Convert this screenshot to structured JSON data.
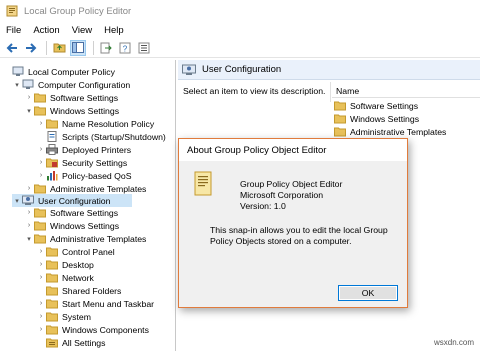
{
  "window": {
    "title": "Local Group Policy Editor"
  },
  "menu": [
    "File",
    "Action",
    "View",
    "Help"
  ],
  "toolbar": {
    "icons": [
      "back-arrow-icon",
      "forward-arrow-icon",
      "folder-up-icon",
      "show-hide-tree-icon",
      "export-list-icon",
      "help-icon",
      "properties-icon"
    ]
  },
  "tree": {
    "items": [
      {
        "label": "Local Computer Policy",
        "icon": "computer-icon",
        "expander": ""
      },
      {
        "label": "Computer Configuration",
        "icon": "computer-icon",
        "expander": "▾"
      },
      {
        "label": "Software Settings",
        "icon": "folder-icon",
        "expander": "›"
      },
      {
        "label": "Windows Settings",
        "icon": "folder-icon",
        "expander": "▾"
      },
      {
        "label": "Name Resolution Policy",
        "icon": "folder-icon",
        "expander": "›"
      },
      {
        "label": "Scripts (Startup/Shutdown)",
        "icon": "script-icon",
        "expander": ""
      },
      {
        "label": "Deployed Printers",
        "icon": "printer-icon",
        "expander": "›"
      },
      {
        "label": "Security Settings",
        "icon": "security-icon",
        "expander": "›"
      },
      {
        "label": "Policy-based QoS",
        "icon": "chart-icon",
        "expander": "›"
      },
      {
        "label": "Administrative Templates",
        "icon": "folder-icon",
        "expander": "›"
      },
      {
        "label": "User Configuration",
        "icon": "user-icon",
        "expander": "▾"
      },
      {
        "label": "Software Settings",
        "icon": "folder-icon",
        "expander": "›"
      },
      {
        "label": "Windows Settings",
        "icon": "folder-icon",
        "expander": "›"
      },
      {
        "label": "Administrative Templates",
        "icon": "folder-icon",
        "expander": "▾"
      },
      {
        "label": "Control Panel",
        "icon": "folder-icon",
        "expander": "›"
      },
      {
        "label": "Desktop",
        "icon": "folder-icon",
        "expander": "›"
      },
      {
        "label": "Network",
        "icon": "folder-icon",
        "expander": "›"
      },
      {
        "label": "Shared Folders",
        "icon": "folder-icon",
        "expander": ""
      },
      {
        "label": "Start Menu and Taskbar",
        "icon": "folder-icon",
        "expander": "›"
      },
      {
        "label": "System",
        "icon": "folder-icon",
        "expander": "›"
      },
      {
        "label": "Windows Components",
        "icon": "folder-icon",
        "expander": "›"
      },
      {
        "label": "All Settings",
        "icon": "settings-icon",
        "expander": ""
      }
    ]
  },
  "right_pane": {
    "header": "User Configuration",
    "description": "Select an item to view its description.",
    "column_name": "Name",
    "items": [
      "Software Settings",
      "Windows Settings",
      "Administrative Templates"
    ]
  },
  "dialog": {
    "title": "About Group Policy Object Editor",
    "product": "Group Policy Object Editor",
    "company": "Microsoft Corporation",
    "version": "Version: 1.0",
    "desc_line1": "This snap-in allows you to edit the local Group",
    "desc_line2": "Policy Objects stored on a computer.",
    "ok_label": "OK"
  },
  "watermark": "wsxdn.com",
  "colors": {
    "selection": "#cce4f7",
    "folder": "#e8c15a",
    "dialog_border": "#e07b3c",
    "ok_border": "#0078d7"
  }
}
